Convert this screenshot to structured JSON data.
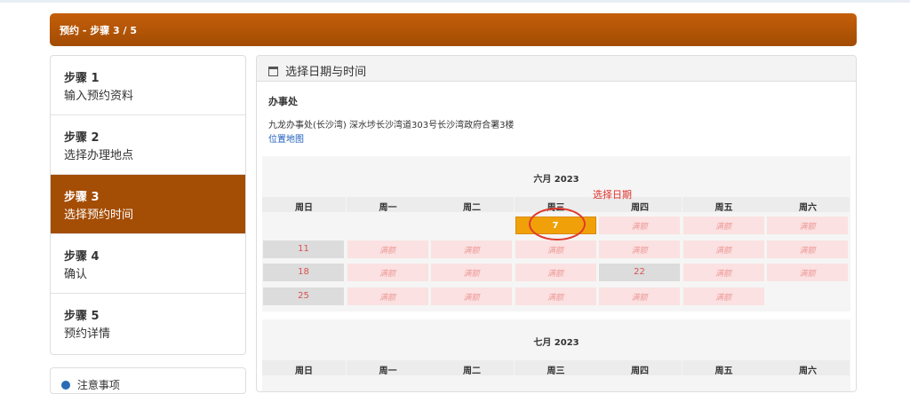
{
  "banner": {
    "title": "预约 - 步骤 3 / 5"
  },
  "steps": [
    {
      "num": "步骤 1",
      "label": "输入预约资料",
      "active": false
    },
    {
      "num": "步骤 2",
      "label": "选择办理地点",
      "active": false
    },
    {
      "num": "步骤 3",
      "label": "选择预约时间",
      "active": true
    },
    {
      "num": "步骤 4",
      "label": "确认",
      "active": false
    },
    {
      "num": "步骤 5",
      "label": "预约详情",
      "active": false
    }
  ],
  "notice": {
    "label": "注意事项"
  },
  "panel": {
    "title": "选择日期与时间",
    "office_title": "办事处",
    "office_address": "九龙办事处(长沙湾) 深水埗长沙湾道303号长沙湾政府合署3楼",
    "map_link": "位置地图"
  },
  "calendar": {
    "hint": "选择日期",
    "weekdays": [
      "周日",
      "周一",
      "周二",
      "周三",
      "周四",
      "周五",
      "周六"
    ],
    "months": [
      {
        "title": "六月 2023",
        "rows": [
          [
            {
              "text": "",
              "state": "empty"
            },
            {
              "text": "",
              "state": "empty"
            },
            {
              "text": "",
              "state": "empty"
            },
            {
              "text": "7",
              "state": "selected"
            },
            {
              "text": "满额",
              "state": "full"
            },
            {
              "text": "满额",
              "state": "full"
            },
            {
              "text": "满额",
              "state": "full"
            }
          ],
          [
            {
              "text": "11",
              "state": "closed"
            },
            {
              "text": "满额",
              "state": "full"
            },
            {
              "text": "满额",
              "state": "full"
            },
            {
              "text": "满额",
              "state": "full"
            },
            {
              "text": "满额",
              "state": "full"
            },
            {
              "text": "满额",
              "state": "full"
            },
            {
              "text": "满额",
              "state": "full"
            }
          ],
          [
            {
              "text": "18",
              "state": "closed"
            },
            {
              "text": "满额",
              "state": "full"
            },
            {
              "text": "满额",
              "state": "full"
            },
            {
              "text": "满额",
              "state": "full"
            },
            {
              "text": "22",
              "state": "closed"
            },
            {
              "text": "满额",
              "state": "full"
            },
            {
              "text": "满额",
              "state": "full"
            }
          ],
          [
            {
              "text": "25",
              "state": "closed"
            },
            {
              "text": "满额",
              "state": "full"
            },
            {
              "text": "满额",
              "state": "full"
            },
            {
              "text": "满额",
              "state": "full"
            },
            {
              "text": "满额",
              "state": "full"
            },
            {
              "text": "满额",
              "state": "full"
            },
            {
              "text": "",
              "state": "empty"
            }
          ]
        ]
      },
      {
        "title": "七月 2023",
        "rows": []
      }
    ]
  }
}
